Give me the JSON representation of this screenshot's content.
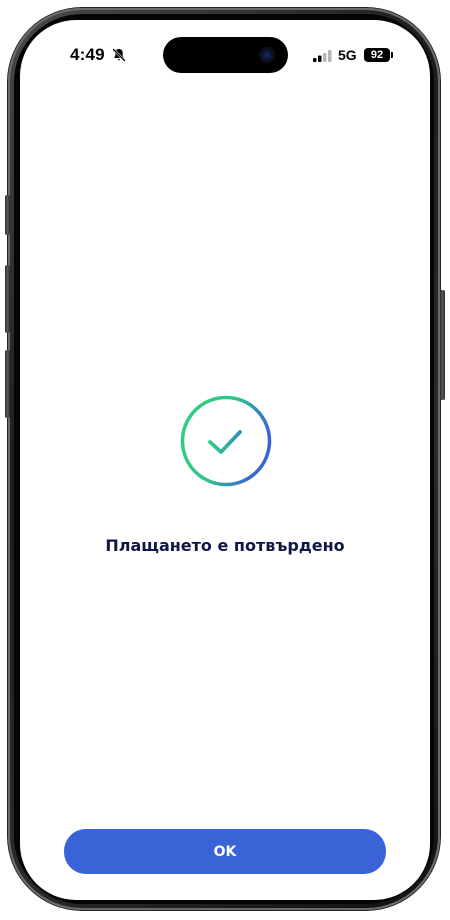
{
  "status_bar": {
    "time": "4:49",
    "silent_icon": "bell-slash-icon",
    "signal_icon": "cellular-signal-icon",
    "network": "5G",
    "battery_level": "92"
  },
  "main": {
    "status_icon": "check-circle-icon",
    "message": "Плащането е потвърдено"
  },
  "footer": {
    "ok_label": "OK"
  },
  "colors": {
    "accent": "#3a63d8",
    "heading": "#101646",
    "check_gradient_start": "#2ed17a",
    "check_gradient_end": "#3a63d8"
  }
}
